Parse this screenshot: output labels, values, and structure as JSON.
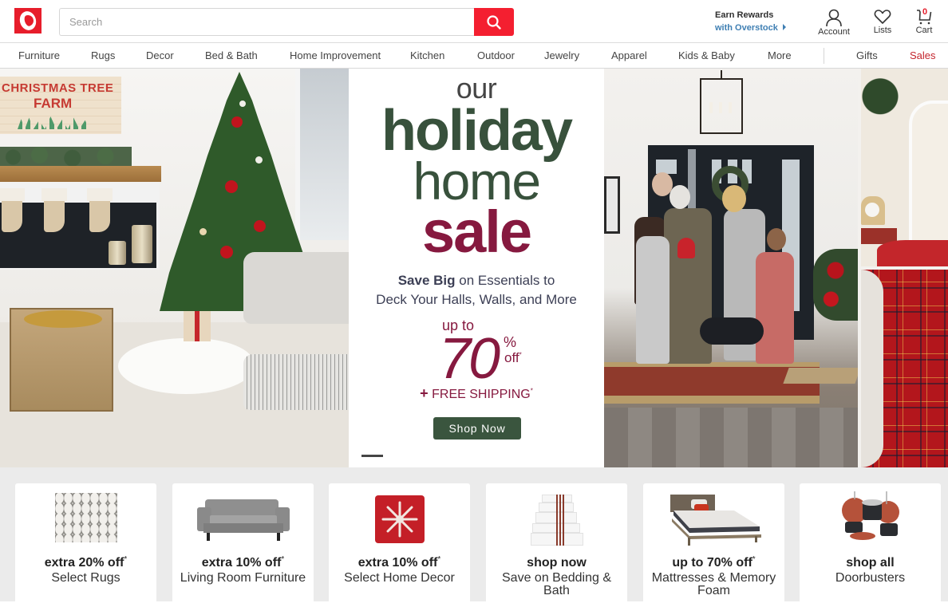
{
  "header": {
    "logo_label": "Overstock",
    "search": {
      "placeholder": "Search",
      "value": ""
    },
    "search_button_icon": "search-icon",
    "rewards": {
      "line1": "Earn Rewards",
      "line2": "with Overstock"
    },
    "account_label": "Account",
    "lists_label": "Lists",
    "cart_label": "Cart",
    "cart_count": "0"
  },
  "nav": {
    "items": [
      {
        "label": "Furniture"
      },
      {
        "label": "Rugs"
      },
      {
        "label": "Decor"
      },
      {
        "label": "Bed & Bath"
      },
      {
        "label": "Home Improvement"
      },
      {
        "label": "Kitchen"
      },
      {
        "label": "Outdoor"
      },
      {
        "label": "Jewelry"
      },
      {
        "label": "Apparel"
      },
      {
        "label": "Kids & Baby"
      },
      {
        "label": "More"
      }
    ],
    "gifts": "Gifts",
    "sales": "Sales"
  },
  "hero": {
    "line_our": "our",
    "line_holiday": "holiday",
    "line_home": "home",
    "line_sale": "sale",
    "save_bold": "Save Big",
    "save_rest": " on Essentials to",
    "save_line2": "Deck Your Halls, Walls, and More",
    "up_to": "up to",
    "percent_value": "70",
    "percent_sign": "%",
    "off": "off",
    "asterisk": "*",
    "plus": "+",
    "free_shipping": "FREE SHIPPING",
    "shop_now": "Shop Now",
    "left_image": {
      "sign_line1": "CHRISTMAS TREE",
      "sign_line2": "FARM"
    }
  },
  "cards": [
    {
      "title": "extra 20% off",
      "asterisk": "*",
      "subtitle": "Select Rugs",
      "image": "rug"
    },
    {
      "title": "extra 10% off",
      "asterisk": "*",
      "subtitle": "Living Room Furniture",
      "image": "sofa"
    },
    {
      "title": "extra 10% off",
      "asterisk": "*",
      "subtitle": "Select Home Decor",
      "image": "snowflake-pillow"
    },
    {
      "title": "shop now",
      "asterisk": "",
      "subtitle": "Save on Bedding & Bath",
      "image": "towels"
    },
    {
      "title": "up to 70% off",
      "asterisk": "*",
      "subtitle": "Mattresses & Memory Foam",
      "image": "bed"
    },
    {
      "title": "shop all",
      "asterisk": "",
      "subtitle": "Doorbusters",
      "image": "cookware"
    }
  ],
  "colors": {
    "brand_red": "#e71d2b",
    "search_button": "#f41f30",
    "rewards_blue": "#3f7fb3",
    "sales_red": "#c4262e",
    "holiday_green": "#38513c",
    "sale_burgundy": "#86193f",
    "shop_button": "#3a553e"
  }
}
